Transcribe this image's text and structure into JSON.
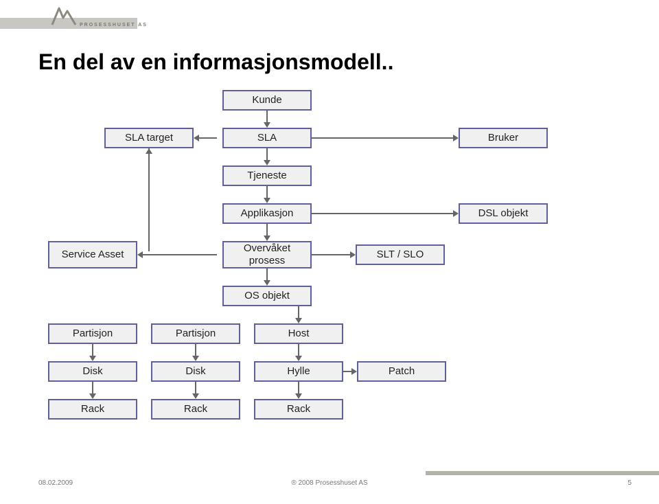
{
  "branding": {
    "logo_text": "PROSESSHUSET AS"
  },
  "slide": {
    "title": "En del av en informasjonsmodell.."
  },
  "nodes": {
    "kunde": "Kunde",
    "sla_target": "SLA target",
    "sla": "SLA",
    "bruker": "Bruker",
    "tjeneste": "Tjeneste",
    "applikasjon": "Applikasjon",
    "dsl_objekt": "DSL  objekt",
    "service_asset": "Service Asset",
    "overvaket_prosess": "Overvåket\nprosess",
    "slt_slo": "SLT / SLO",
    "os_objekt": "OS objekt",
    "partisjon": "Partisjon",
    "host": "Host",
    "disk": "Disk",
    "hylle": "Hylle",
    "patch": "Patch",
    "rack": "Rack"
  },
  "footer": {
    "date": "08.02.2009",
    "copyright": "® 2008 Prosesshuset AS",
    "page": "5"
  }
}
